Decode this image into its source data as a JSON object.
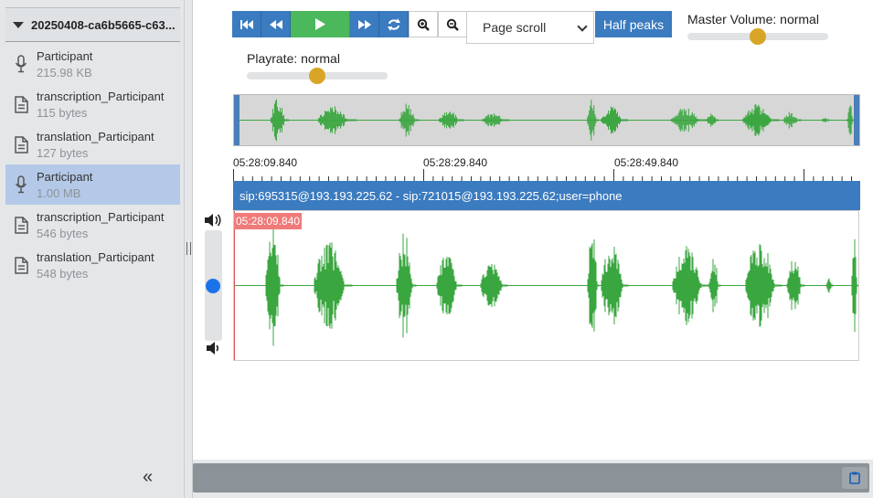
{
  "sidebar": {
    "header_title": "20250408-ca6b5665-c63...",
    "files": [
      {
        "name": "Participant",
        "size": "215.98 KB",
        "icon": "microphone-icon",
        "selected": false
      },
      {
        "name": "transcription_Participant",
        "size": "115 bytes",
        "icon": "document-icon",
        "selected": false
      },
      {
        "name": "translation_Participant",
        "size": "127 bytes",
        "icon": "document-icon",
        "selected": false
      },
      {
        "name": "Participant",
        "size": "1.00 MB",
        "icon": "microphone-icon",
        "selected": true
      },
      {
        "name": "transcription_Participant",
        "size": "546 bytes",
        "icon": "document-icon",
        "selected": false
      },
      {
        "name": "translation_Participant",
        "size": "548 bytes",
        "icon": "document-icon",
        "selected": false
      }
    ],
    "collapse_label": "«"
  },
  "toolbar": {
    "scroll_mode": "Page scroll",
    "half_peaks_label": "Half peaks",
    "master_volume_label": "Master Volume: normal",
    "master_volume_level": 0.5,
    "playrate_label": "Playrate: normal",
    "playrate_level": 0.5
  },
  "timeline": {
    "ticks": [
      "05:28:09.840",
      "05:28:29.840",
      "05:28:49.840"
    ]
  },
  "track": {
    "title": "sip:695315@193.193.225.62 - sip:721015@193.193.225.62;user=phone",
    "cursor_time": "05:28:09.840",
    "volume_level": 0.5
  },
  "colors": {
    "accent": "#3b7bbf",
    "play": "#4cb85c",
    "waveform": "#3aa63f",
    "cursor": "#f07a7a",
    "knob": "#d8a526",
    "selected_row": "#b4c9e8"
  }
}
